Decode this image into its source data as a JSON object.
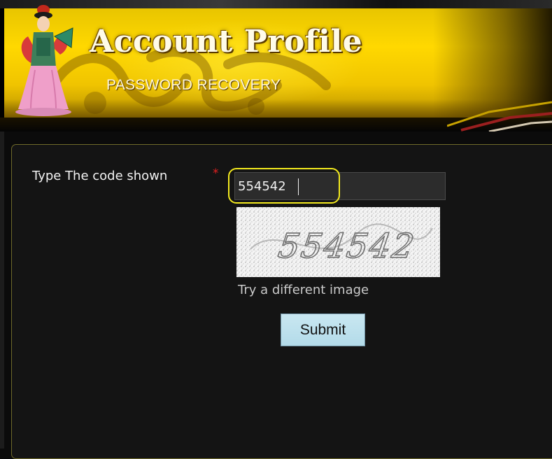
{
  "header": {
    "title": "Account Profile",
    "subtitle": "PASSWORD RECOVERY",
    "mascot_icon": "dancer-figure-icon",
    "decor_icon": "dragon-silhouette-icon"
  },
  "form": {
    "code_label": "Type The code shown",
    "required_marker": "*",
    "code_value": "554542",
    "captcha_text": "554542",
    "try_different_label": "Try a different image",
    "submit_label": "Submit"
  },
  "colors": {
    "banner_gold": "#ffd800",
    "panel_bg": "#141414",
    "panel_border": "#6f6a2a",
    "highlight_ring": "#f3ea1e",
    "required_red": "#e02020",
    "button_bg": "#c9e7f1"
  }
}
